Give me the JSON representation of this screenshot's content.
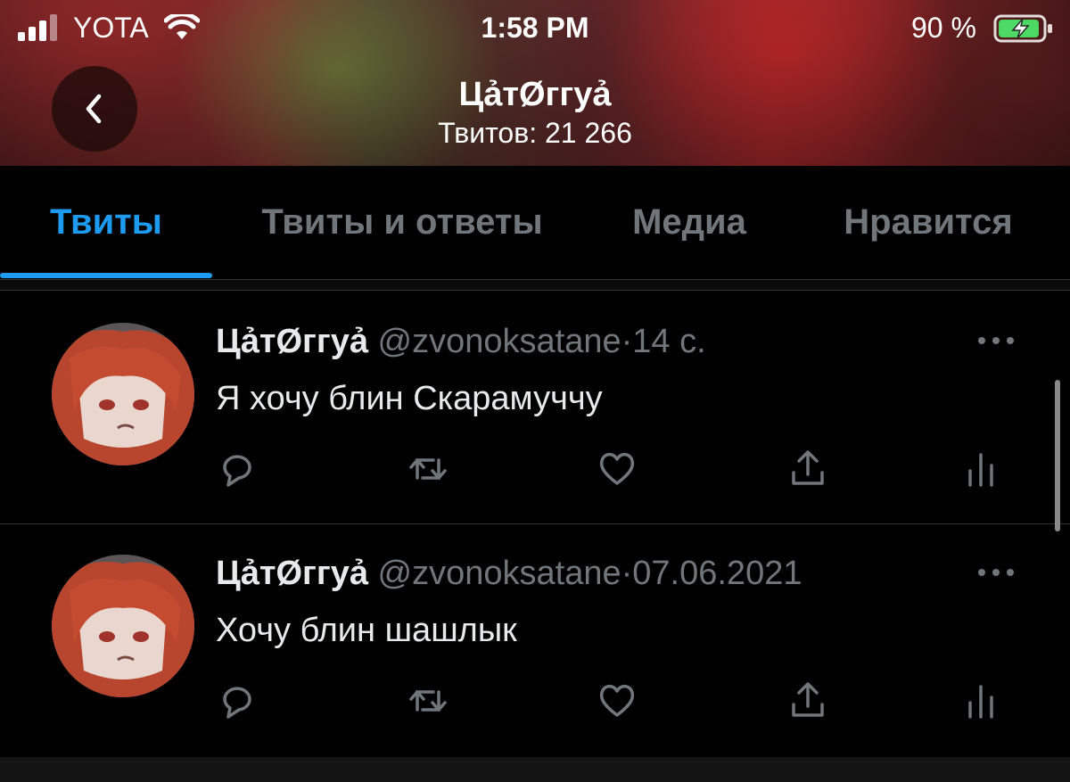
{
  "status_bar": {
    "carrier": "YOTA",
    "time": "1:58 PM",
    "battery_percent": "90 %",
    "signal_icon": "cellular-signal-icon",
    "wifi_icon": "wifi-icon",
    "battery_icon": "battery-charging-icon"
  },
  "header": {
    "title": "Цả​т​Ø​г​г​у​ả",
    "subtitle": "Твитов: 21 266",
    "back_icon": "chevron-left-icon"
  },
  "tabs": [
    {
      "label": "Твиты",
      "active": true
    },
    {
      "label": "Твиты и ответы",
      "active": false
    },
    {
      "label": "Медиа",
      "active": false
    },
    {
      "label": "Нравится",
      "active": false
    }
  ],
  "tweets": [
    {
      "name": "ЦảтØггуả",
      "handle": "@zvonoksatane",
      "separator": "·",
      "time": "14 с.",
      "text": "Я хочу блин Скарамуччу"
    },
    {
      "name": "ЦảтØггуả",
      "handle": "@zvonoksatane",
      "separator": "·",
      "time": "07.06.2021",
      "text": "Хочу блин шашлык"
    }
  ],
  "colors": {
    "accent": "#1d9bf0",
    "muted": "#71767b",
    "background": "#000000"
  }
}
